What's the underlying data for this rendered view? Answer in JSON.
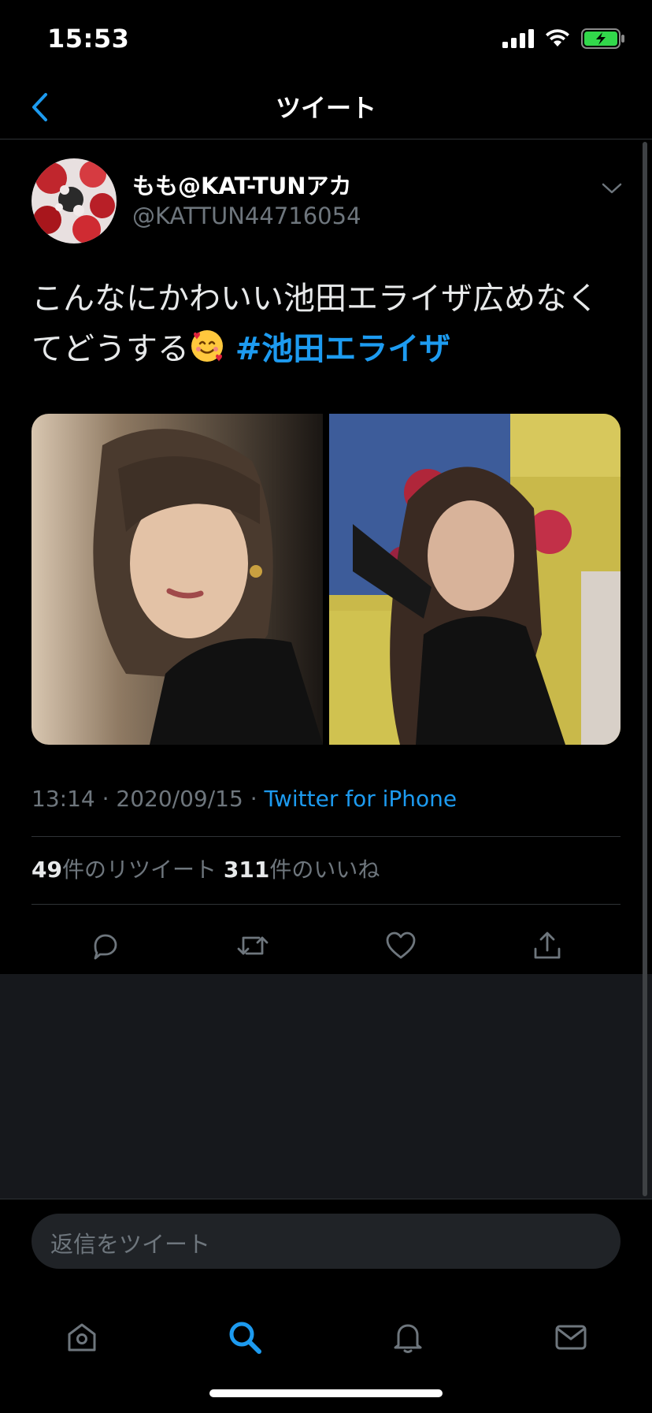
{
  "status_bar": {
    "time": "15:53"
  },
  "nav": {
    "title": "ツイート"
  },
  "tweet": {
    "author_name": "もも@KAT-TUNアカ",
    "author_handle": "@KATTUN44716054",
    "text": "こんなにかわいい池田エライザ広めなくてどうする",
    "hashtag": "#池田エライザ",
    "time": "13:14",
    "date": "2020/09/15",
    "source": "Twitter for iPhone",
    "retweet_count": "49",
    "retweet_label": "件のリツイート",
    "like_count": "311",
    "like_label": "件のいいね"
  },
  "reply": {
    "placeholder": "返信をツイート"
  },
  "colors": {
    "accent": "#1d9bf0",
    "background": "#000000",
    "secondary_text": "#6e767d"
  },
  "icons": [
    "back-chevron-icon",
    "chevron-down-icon",
    "reply-icon",
    "retweet-icon",
    "like-icon",
    "share-icon",
    "home-icon",
    "search-icon",
    "notifications-icon",
    "messages-icon",
    "signal-icon",
    "wifi-icon",
    "battery-icon"
  ]
}
